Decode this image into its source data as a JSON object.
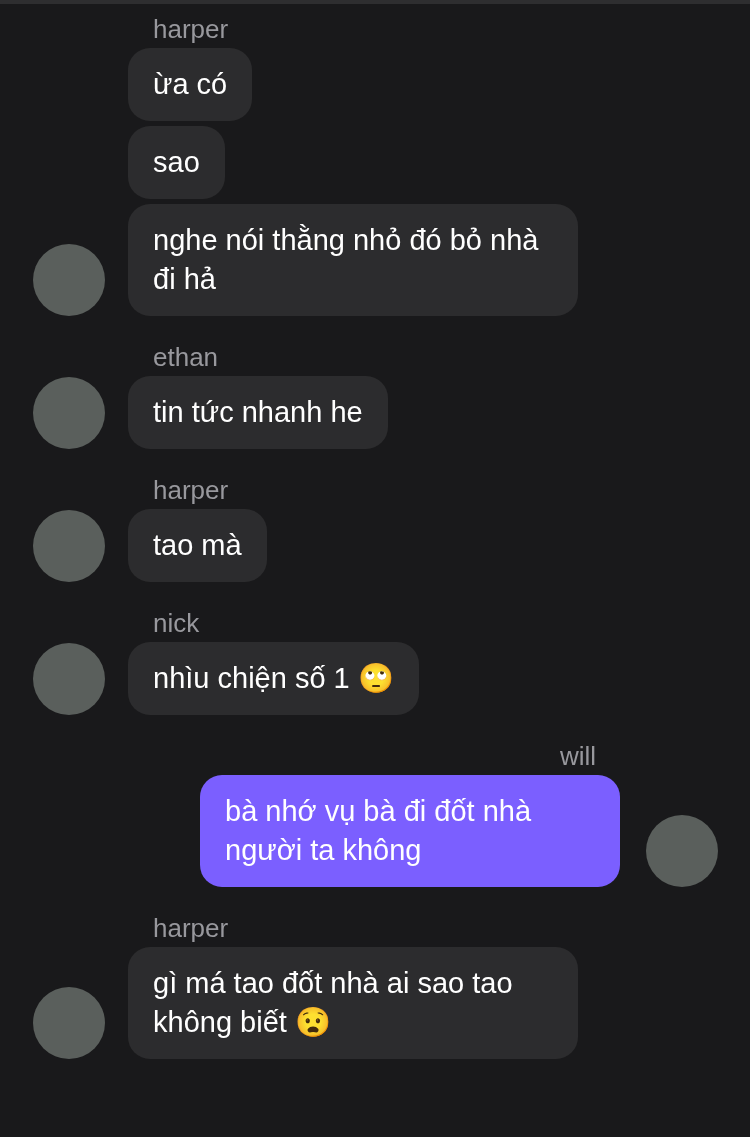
{
  "groups": [
    {
      "sender": "harper",
      "outgoing": false,
      "bubbles": [
        "ừa có",
        "sao",
        "nghe nói thằng nhỏ đó bỏ nhà đi hả"
      ]
    },
    {
      "sender": "ethan",
      "outgoing": false,
      "bubbles": [
        "tin tức nhanh he"
      ]
    },
    {
      "sender": "harper",
      "outgoing": false,
      "bubbles": [
        "tao mà"
      ]
    },
    {
      "sender": "nick",
      "outgoing": false,
      "bubbles": [
        "nhìu chiện số 1 🙄"
      ]
    },
    {
      "sender": "will",
      "outgoing": true,
      "bubbles": [
        "bà nhớ vụ bà đi đốt nhà người ta không"
      ]
    },
    {
      "sender": "harper",
      "outgoing": false,
      "bubbles": [
        "gì má tao đốt nhà ai sao tao không biết 😧"
      ]
    }
  ]
}
